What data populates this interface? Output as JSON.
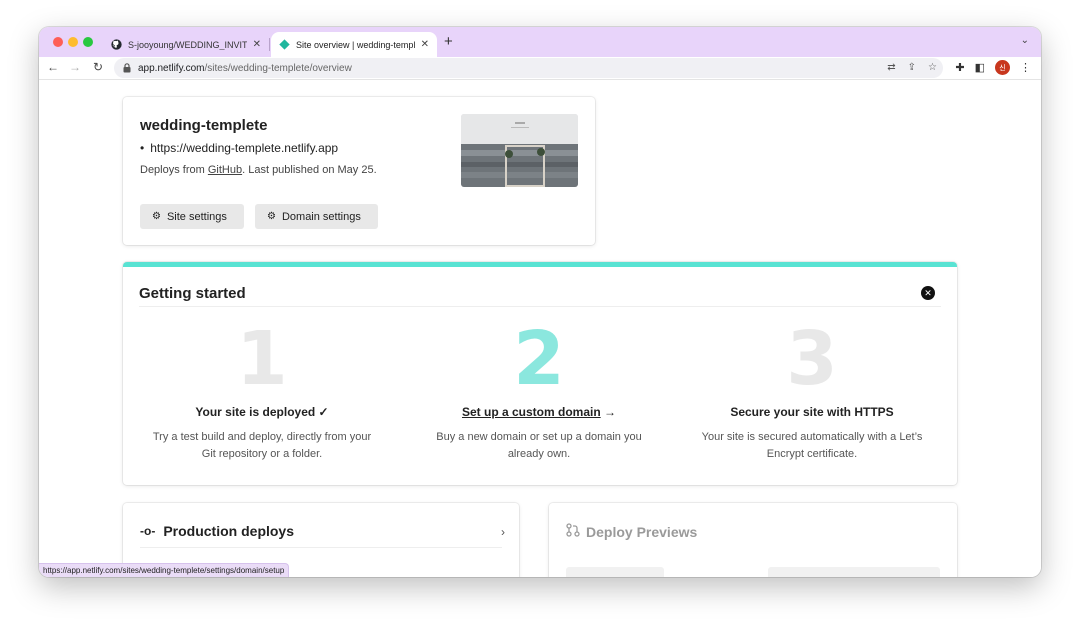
{
  "browser": {
    "tabs": [
      {
        "title": "S-jooyoung/WEDDING_INVITATION",
        "icon": "github-icon",
        "close": "✕"
      },
      {
        "title": "Site overview | wedding-templete",
        "icon": "netlify-icon",
        "close": "✕"
      }
    ],
    "new_tab": "+",
    "tab_menu": "⌄",
    "url_host": "app.netlify.com",
    "url_path": "/sites/wedding-templete/overview",
    "avatar_initial": "신",
    "status_url": "https://app.netlify.com/sites/wedding-templete/settings/domain/setup"
  },
  "site": {
    "name": "wedding-templete",
    "url": "https://wedding-templete.netlify.app",
    "deploys_prefix": "Deploys from ",
    "deploys_link": "GitHub",
    "deploys_suffix": ". Last published on May 25.",
    "buttons": {
      "site_settings": "Site settings",
      "domain_settings": "Domain settings"
    }
  },
  "getting_started": {
    "title": "Getting started",
    "steps": [
      {
        "number": "1",
        "title": "Your site is deployed ✓",
        "desc": "Try a test build and deploy, directly from your Git repository or a folder."
      },
      {
        "number": "2",
        "title": "Set up a custom domain",
        "arrow": " →",
        "desc": "Buy a new domain or set up a domain you already own."
      },
      {
        "number": "3",
        "title": "Secure your site with HTTPS",
        "desc": "Your site is secured automatically with a Let’s Encrypt certificate."
      }
    ]
  },
  "production_deploys": {
    "title": "Production deploys",
    "chevron": "›"
  },
  "deploy_previews": {
    "title": "Deploy Previews"
  },
  "colors": {
    "accent": "#59e3d3",
    "tab_strip": "#e8d4fa",
    "step_active": "#8be7de"
  }
}
